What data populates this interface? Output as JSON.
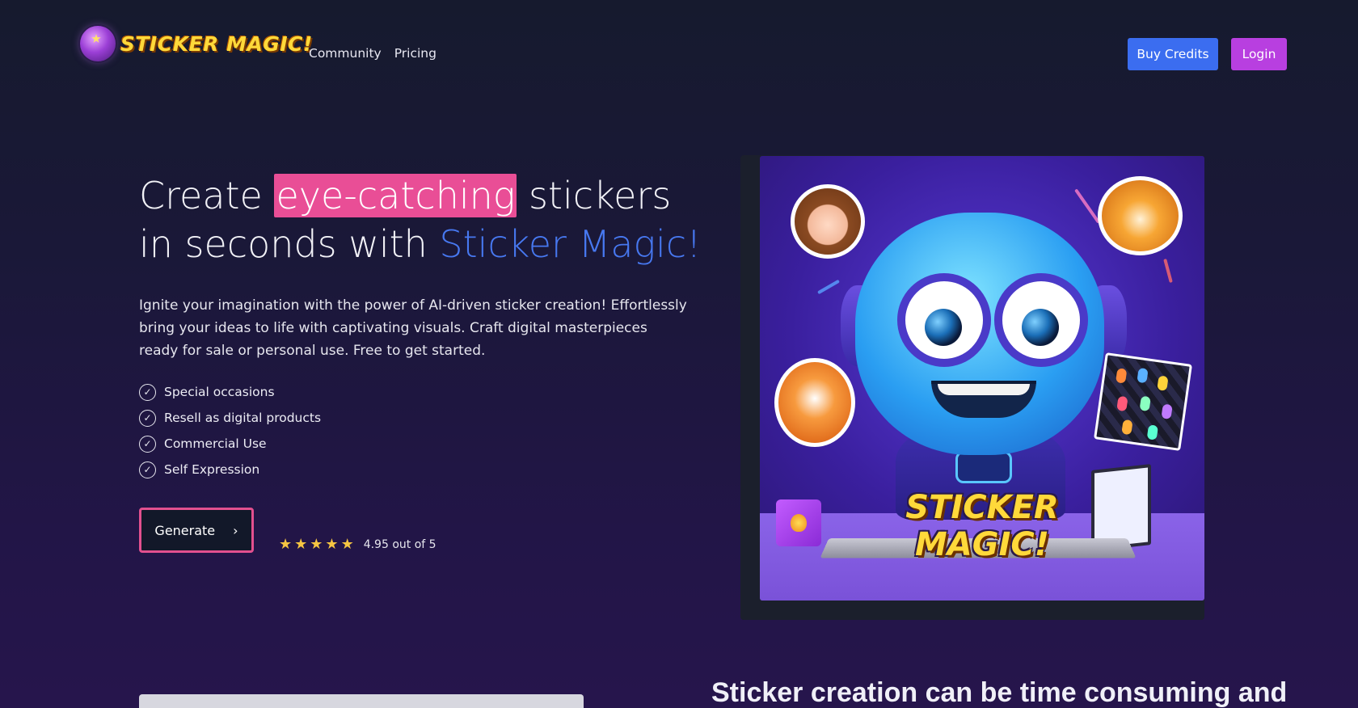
{
  "brand": {
    "name": "STICKER MAGIC!",
    "logo_icon": "magic-orb-icon"
  },
  "nav": {
    "links": [
      "Community",
      "Pricing"
    ],
    "buy_credits": "Buy Credits",
    "login": "Login"
  },
  "hero": {
    "headline_before": "Create ",
    "headline_highlight": "eye-catching",
    "headline_middle": " stickers in seconds with ",
    "headline_brand": "Sticker Magic!",
    "lead": "Ignite your imagination with the power of AI-driven sticker creation! Effortlessly bring your ideas to life with captivating visuals. Craft digital masterpieces ready for sale or personal use. Free to get started.",
    "features": [
      "Special occasions",
      "Resell as digital products",
      "Commercial Use",
      "Self Expression"
    ],
    "cta_label": "Generate",
    "cta_icon": "chevron-right-icon",
    "rating_stars": 5,
    "rating_text": "4.95 out of 5",
    "art_title": "STICKER MAGIC!"
  },
  "section": {
    "heading": "Sticker creation can be time consuming and"
  },
  "colors": {
    "highlight": "#e94e96",
    "brand_blue": "#4778f0",
    "buy_credits_bg": "#3b6df0",
    "login_bg": "#b83fe0",
    "cta_border": "#e2508f",
    "star": "#f5c542"
  }
}
